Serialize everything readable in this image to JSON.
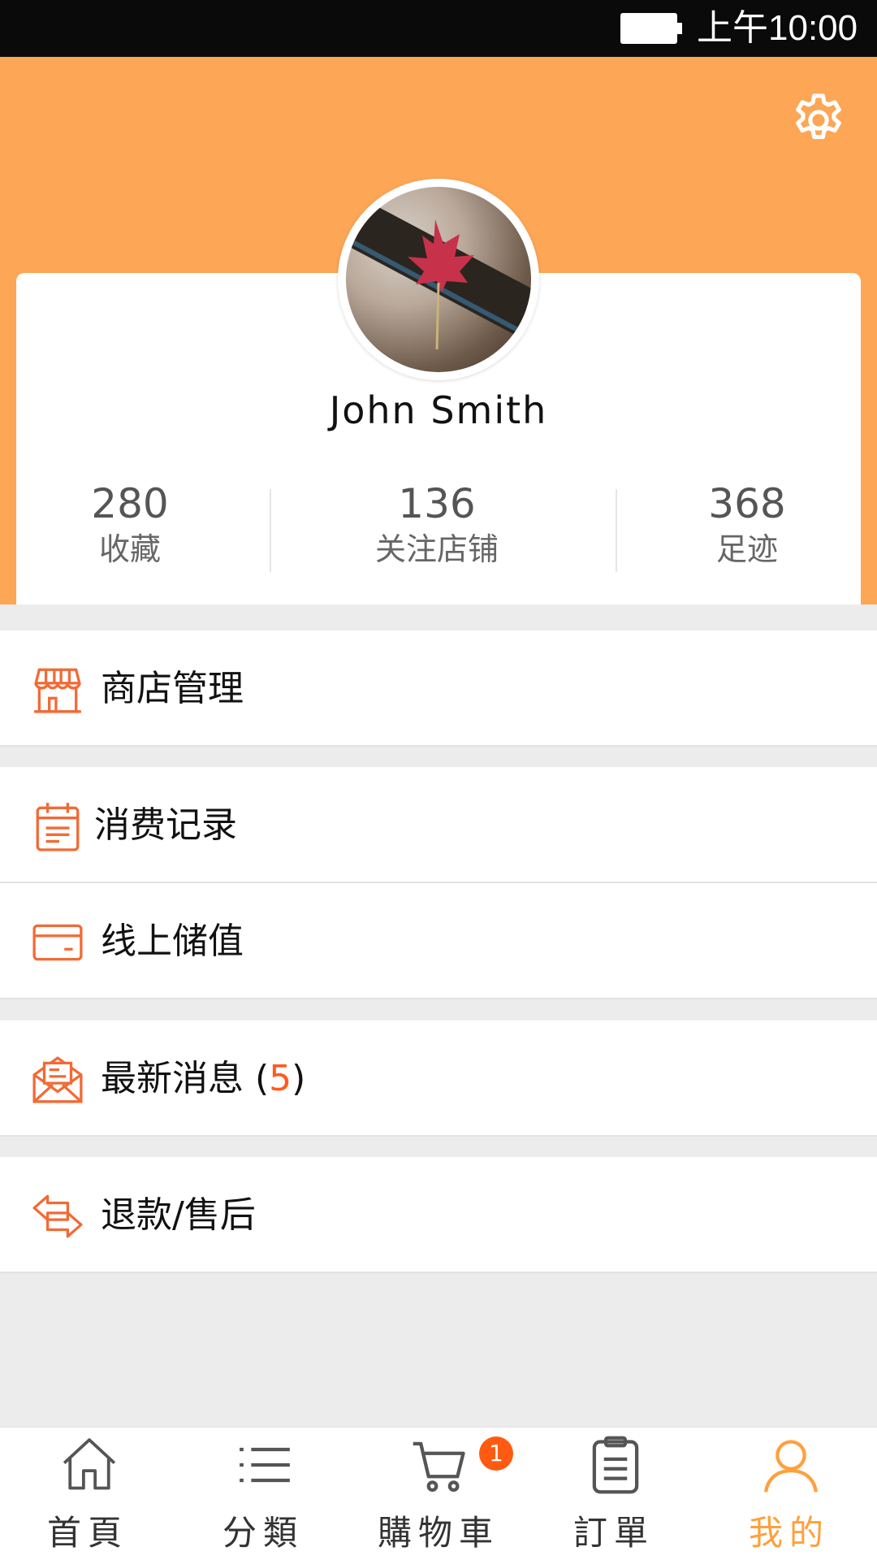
{
  "status_bar": {
    "time": "上午10:00"
  },
  "profile": {
    "name": "John Smith",
    "stats": [
      {
        "value": "280",
        "label": "收藏"
      },
      {
        "value": "136",
        "label": "关注店铺"
      },
      {
        "value": "368",
        "label": "足迹"
      }
    ]
  },
  "menu": {
    "store_management": "商店管理",
    "spending_records": "消费记录",
    "online_topup": "线上储值",
    "latest_messages": "最新消息",
    "latest_messages_count": "5",
    "refund_aftersales": "退款/售后"
  },
  "tabs": [
    {
      "label": "首頁",
      "icon": "home-icon"
    },
    {
      "label": "分類",
      "icon": "list-icon"
    },
    {
      "label": "購物車",
      "icon": "cart-icon"
    },
    {
      "label": "訂單",
      "icon": "clipboard-icon"
    },
    {
      "label": "我的",
      "icon": "person-icon"
    }
  ],
  "cart_badge": "1",
  "colors": {
    "header": "#fda655",
    "accent_icon": "#f26a35",
    "active_tab": "#ffa03c",
    "badge": "#ff5a12"
  }
}
